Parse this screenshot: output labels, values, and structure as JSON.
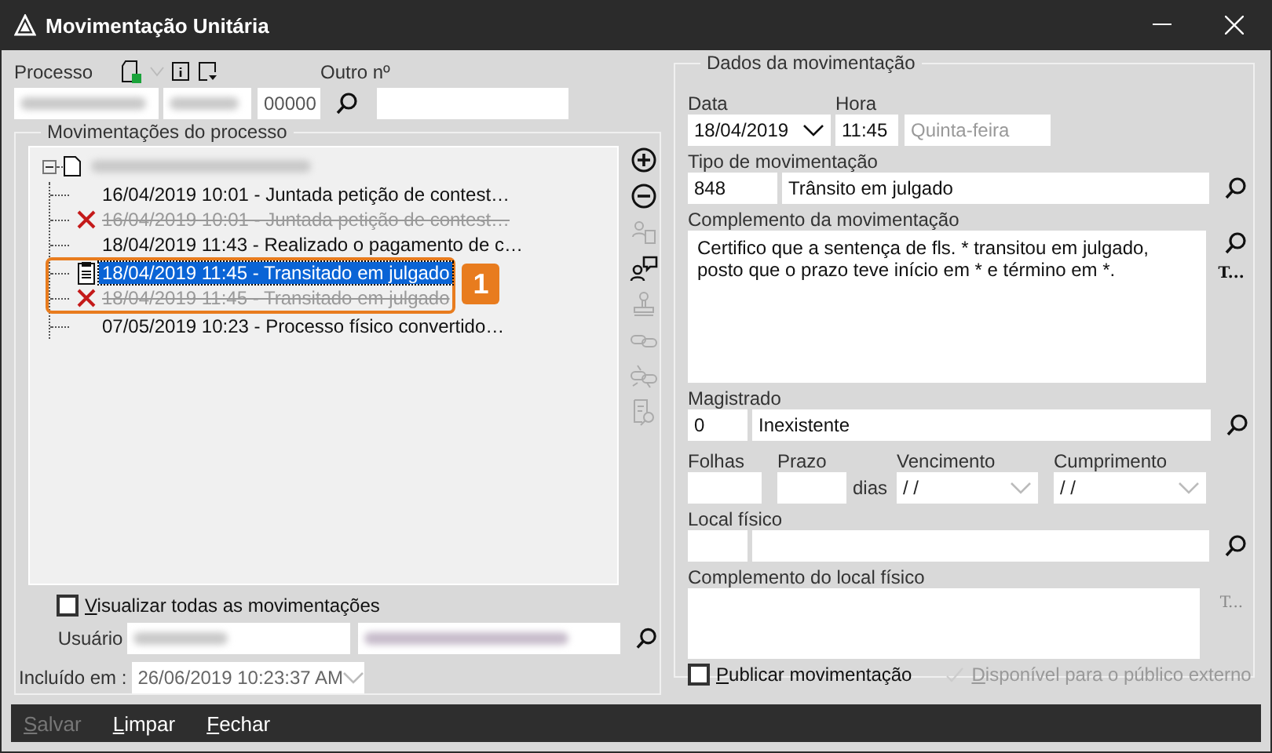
{
  "window": {
    "title": "Movimentação Unitária"
  },
  "processo": {
    "label": "Processo",
    "number_suffix": "00000",
    "other_label": "Outro nº"
  },
  "movements": {
    "title": "Movimentações do processo",
    "root_expanded": true,
    "badge": "1",
    "items": [
      {
        "text": "16/04/2019 10:01 - Juntada petição de contest…",
        "kind": "plain",
        "selected": false,
        "highlighted": false
      },
      {
        "text": "16/04/2019 10:01 - Juntada petição de contest…",
        "kind": "deleted",
        "selected": false,
        "highlighted": false
      },
      {
        "text": "18/04/2019 11:43 - Realizado o pagamento de c…",
        "kind": "plain",
        "selected": false,
        "highlighted": false
      },
      {
        "text": "18/04/2019 11:45 - Transitado em julgado",
        "kind": "document",
        "selected": true,
        "highlighted": true
      },
      {
        "text": "18/04/2019 11:45 - Transitado em julgado",
        "kind": "deleted",
        "selected": false,
        "highlighted": true
      },
      {
        "text": "07/05/2019 10:23 - Processo físico convertido…",
        "kind": "plain",
        "selected": false,
        "highlighted": false
      }
    ]
  },
  "tools": [
    {
      "kind": "add",
      "disabled": false
    },
    {
      "kind": "remove",
      "disabled": false
    },
    {
      "kind": "person-doc",
      "disabled": true
    },
    {
      "kind": "person-comment",
      "disabled": false
    },
    {
      "kind": "stamp",
      "disabled": true
    },
    {
      "kind": "link",
      "disabled": true
    },
    {
      "kind": "unlink",
      "disabled": true
    },
    {
      "kind": "doc-search",
      "disabled": true
    }
  ],
  "show_all": {
    "label": "Visualizar todas as movimentações",
    "checked": false
  },
  "user": {
    "label": "Usuário"
  },
  "included": {
    "label": "Incluído em :",
    "value": "26/06/2019 10:23:37 AM"
  },
  "details": {
    "title": "Dados da movimentação",
    "date": {
      "label": "Data",
      "value": "18/04/2019"
    },
    "time": {
      "label": "Hora",
      "value": "11:45"
    },
    "weekday": "Quinta-feira",
    "type": {
      "label": "Tipo de movimentação",
      "code": "848",
      "name": "Trânsito em julgado"
    },
    "complement": {
      "label": "Complemento da movimentação",
      "text": "Certifico que a sentença de fls. * transitou em julgado, posto que o prazo teve início em * e término em *.",
      "side_button": "T...",
      "side_disabled": false
    },
    "magistrate": {
      "label": "Magistrado",
      "code": "0",
      "name": "Inexistente"
    },
    "folhas": {
      "label": "Folhas"
    },
    "prazo": {
      "label": "Prazo",
      "unit": "dias"
    },
    "vencimento": {
      "label": "Vencimento",
      "value": "/ /"
    },
    "cumprimento": {
      "label": "Cumprimento",
      "value": "/ /"
    },
    "local": {
      "label": "Local físico"
    },
    "local_complement": {
      "label": "Complemento do local físico",
      "side_button": "T...",
      "side_disabled": true
    },
    "publish": {
      "label": "Publicar movimentação",
      "checked": false
    },
    "public": {
      "label": "Disponível para o público externo",
      "checked": true,
      "disabled": true
    }
  },
  "buttons": [
    {
      "label": "Salvar",
      "disabled": true
    },
    {
      "label": "Limpar",
      "disabled": false
    },
    {
      "label": "Fechar",
      "disabled": false
    }
  ]
}
